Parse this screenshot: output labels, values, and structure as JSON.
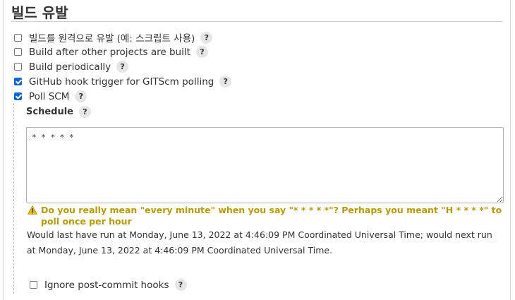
{
  "section": {
    "title": "빌드 유발"
  },
  "triggers": [
    {
      "label": "빌드를 원격으로 유발 (예: 스크립트 사용)",
      "checked": false,
      "help": "?"
    },
    {
      "label": "Build after other projects are built",
      "checked": false,
      "help": "?"
    },
    {
      "label": "Build periodically",
      "checked": false,
      "help": "?"
    },
    {
      "label": "GitHub hook trigger for GITScm polling",
      "checked": true,
      "help": "?"
    },
    {
      "label": "Poll SCM",
      "checked": true,
      "help": "?"
    }
  ],
  "schedule": {
    "label": "Schedule",
    "help": "?",
    "value": "* * * * *",
    "warning": "Do you really mean \"every minute\" when you say \"* * * * *\"? Perhaps you meant \"H * * * *\" to poll once per hour",
    "info": "Would last have run at Monday, June 13, 2022 at 4:46:09 PM Coordinated Universal Time; would next run at Monday, June 13, 2022 at 4:46:09 PM Coordinated Universal Time."
  },
  "ignore_hooks": {
    "label": "Ignore post-commit hooks",
    "checked": false,
    "help": "?"
  },
  "colors": {
    "accent": "#0a66d8",
    "warning": "#bd9a00"
  }
}
